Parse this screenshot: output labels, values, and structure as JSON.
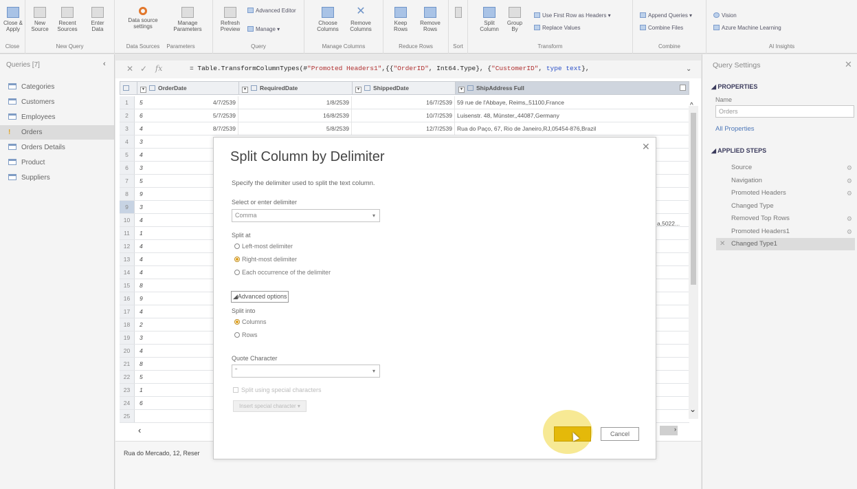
{
  "ribbon": {
    "groups": {
      "close": "Close",
      "new_query": "New Query",
      "data_sources": "Data Sources",
      "parameters": "Parameters",
      "query": "Query",
      "manage_columns": "Manage Columns",
      "reduce_rows": "Reduce Rows",
      "sort": "Sort",
      "transform": "Transform",
      "combine": "Combine",
      "ai_insights": "AI Insights"
    },
    "buttons": {
      "close_apply": "Close & Apply",
      "new_source": "New Source",
      "recent_sources": "Recent Sources",
      "enter_data": "Enter Data",
      "data_source_settings": "Data source settings",
      "manage_parameters": "Manage Parameters",
      "refresh_preview": "Refresh Preview",
      "advanced_editor": "Advanced Editor",
      "manage": "Manage",
      "choose_columns": "Choose Columns",
      "remove_columns": "Remove Columns",
      "keep_rows": "Keep Rows",
      "remove_rows": "Remove Rows",
      "split_column": "Split Column",
      "group_by": "Group By",
      "use_first_row": "Use First Row as Headers",
      "replace_values": "Replace Values",
      "append_queries": "Append Queries",
      "combine_files": "Combine Files",
      "vision": "Vision",
      "azure_ml": "Azure Machine Learning"
    }
  },
  "queries": {
    "header": "Queries [7]",
    "items": [
      {
        "label": "Categories",
        "active": false
      },
      {
        "label": "Customers",
        "active": false
      },
      {
        "label": "Employees",
        "active": false
      },
      {
        "label": "Orders",
        "active": true
      },
      {
        "label": "Orders Details",
        "active": false
      },
      {
        "label": "Product",
        "active": false
      },
      {
        "label": "Suppliers",
        "active": false
      }
    ]
  },
  "formula": {
    "prefix": "= Table.TransformColumnTypes(#",
    "s1": "\"Promoted Headers1\"",
    "mid1": ",{{",
    "s2": "\"OrderID\"",
    "mid2": ", Int64.Type}, {",
    "s3": "\"CustomerID\"",
    "mid3": ", ",
    "kw": "type text",
    "suffix": "},"
  },
  "grid": {
    "headers": {
      "col2": "OrderDate",
      "col3": "RequiredDate",
      "col4": "ShippedDate",
      "col5": "ShipAddress Full"
    },
    "rows": [
      {
        "n": "1",
        "c1": "5",
        "c2": "4/7/2539",
        "c3": "1/8/2539",
        "c4": "16/7/2539",
        "c5": "59 rue de l'Abbaye, Reims,,51100,France"
      },
      {
        "n": "2",
        "c1": "6",
        "c2": "5/7/2539",
        "c3": "16/8/2539",
        "c4": "10/7/2539",
        "c5": "Luisenstr. 48, Münster,,44087,Germany"
      },
      {
        "n": "3",
        "c1": "4",
        "c2": "8/7/2539",
        "c3": "5/8/2539",
        "c4": "12/7/2539",
        "c5": "Rua do Paço, 67, Rio de Janeiro,RJ,05454-876,Brazil"
      },
      {
        "n": "4",
        "c1": "3",
        "c2": "",
        "c3": "",
        "c4": "",
        "c5": ""
      },
      {
        "n": "5",
        "c1": "4",
        "c2": "",
        "c3": "",
        "c4": "",
        "c5": ""
      },
      {
        "n": "6",
        "c1": "3",
        "c2": "",
        "c3": "",
        "c4": "",
        "c5": ""
      },
      {
        "n": "7",
        "c1": "5",
        "c2": "",
        "c3": "",
        "c4": "",
        "c5": ""
      },
      {
        "n": "8",
        "c1": "9",
        "c2": "",
        "c3": "",
        "c4": "",
        "c5": ""
      },
      {
        "n": "9",
        "c1": "3",
        "c2": "",
        "c3": "",
        "c4": "",
        "c5": ""
      },
      {
        "n": "10",
        "c1": "4",
        "c2": "",
        "c3": "",
        "c4": "",
        "c5": ""
      },
      {
        "n": "11",
        "c1": "1",
        "c2": "",
        "c3": "",
        "c4": "",
        "c5": ""
      },
      {
        "n": "12",
        "c1": "4",
        "c2": "",
        "c3": "",
        "c4": "",
        "c5": ""
      },
      {
        "n": "13",
        "c1": "4",
        "c2": "",
        "c3": "",
        "c4": "",
        "c5": ""
      },
      {
        "n": "14",
        "c1": "4",
        "c2": "",
        "c3": "",
        "c4": "",
        "c5": ""
      },
      {
        "n": "15",
        "c1": "8",
        "c2": "",
        "c3": "",
        "c4": "",
        "c5": ""
      },
      {
        "n": "16",
        "c1": "9",
        "c2": "",
        "c3": "",
        "c4": "",
        "c5": ""
      },
      {
        "n": "17",
        "c1": "4",
        "c2": "",
        "c3": "",
        "c4": "",
        "c5": ""
      },
      {
        "n": "18",
        "c1": "2",
        "c2": "",
        "c3": "",
        "c4": "",
        "c5": ""
      },
      {
        "n": "19",
        "c1": "3",
        "c2": "",
        "c3": "",
        "c4": "",
        "c5": ""
      },
      {
        "n": "20",
        "c1": "4",
        "c2": "",
        "c3": "",
        "c4": "",
        "c5": ""
      },
      {
        "n": "21",
        "c1": "8",
        "c2": "",
        "c3": "",
        "c4": "",
        "c5": ""
      },
      {
        "n": "22",
        "c1": "5",
        "c2": "",
        "c3": "",
        "c4": "",
        "c5": ""
      },
      {
        "n": "23",
        "c1": "1",
        "c2": "",
        "c3": "",
        "c4": "",
        "c5": ""
      },
      {
        "n": "24",
        "c1": "6",
        "c2": "",
        "c3": "",
        "c4": "",
        "c5": ""
      },
      {
        "n": "25",
        "c1": "",
        "c2": "",
        "c3": "",
        "c4": "",
        "c5": ""
      }
    ],
    "cell_extra": "a,5022...",
    "footer_text": "Rua do Mercado, 12, Reser"
  },
  "settings": {
    "title": "Query Settings",
    "properties_header": "PROPERTIES",
    "name_label": "Name",
    "name_value": "Orders",
    "all_properties": "All Properties",
    "applied_steps_header": "APPLIED STEPS",
    "steps": [
      {
        "label": "Source",
        "gear": true
      },
      {
        "label": "Navigation",
        "gear": true
      },
      {
        "label": "Promoted Headers",
        "gear": true
      },
      {
        "label": "Changed Type",
        "gear": false
      },
      {
        "label": "Removed Top Rows",
        "gear": true
      },
      {
        "label": "Promoted Headers1",
        "gear": true
      },
      {
        "label": "Changed Type1",
        "gear": false
      }
    ]
  },
  "modal": {
    "title": "Split Column by Delimiter",
    "description": "Specify the delimiter used to split the text column.",
    "delimiter_label": "Select or enter delimiter",
    "delimiter_value": "Comma",
    "split_at_label": "Split at",
    "split_options": [
      {
        "label": "Left-most delimiter",
        "checked": false
      },
      {
        "label": "Right-most delimiter",
        "checked": true
      },
      {
        "label": "Each occurrence of the delimiter",
        "checked": false
      }
    ],
    "advanced_options": "Advanced options",
    "split_into_label": "Split into",
    "split_into_options": [
      {
        "label": "Columns",
        "checked": true
      },
      {
        "label": "Rows",
        "checked": false
      }
    ],
    "quote_label": "Quote Character",
    "quote_value": "\"",
    "special_chars_label": "Split using special characters",
    "insert_special": "Insert special character",
    "cancel": "Cancel"
  }
}
